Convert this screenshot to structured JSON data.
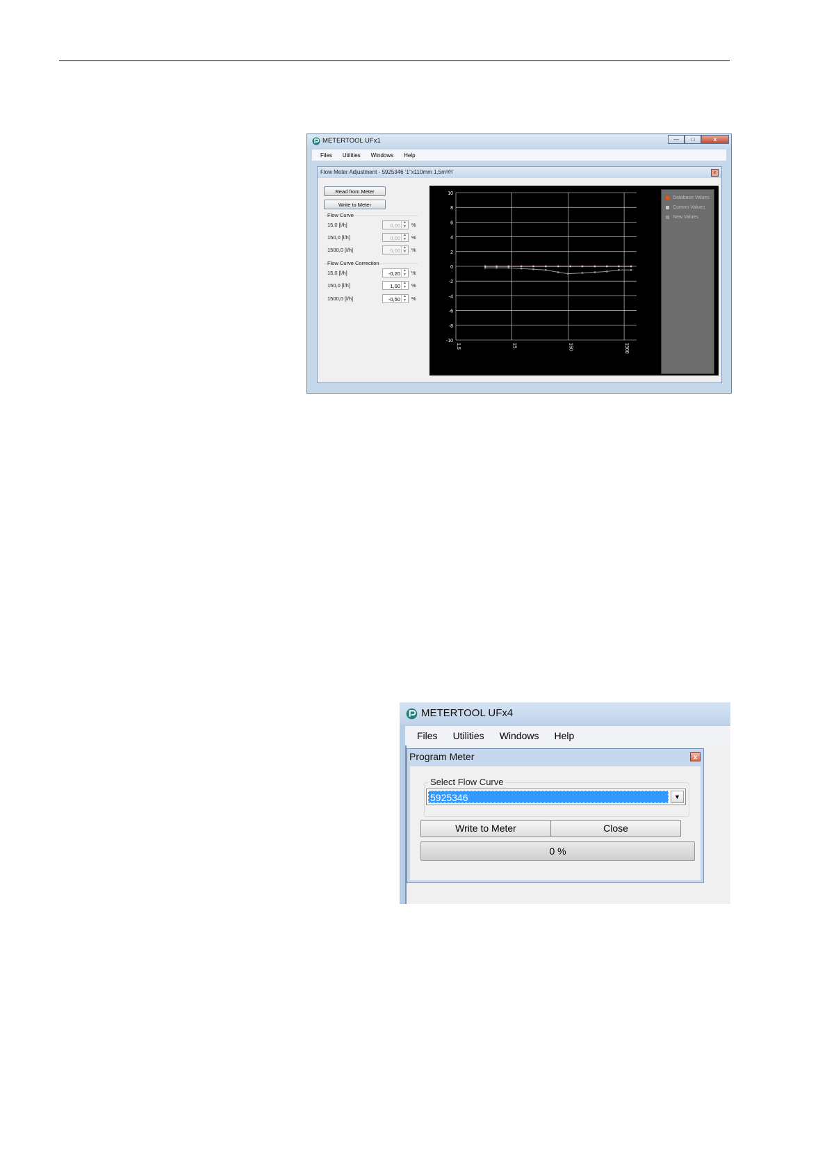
{
  "window1": {
    "title": "METERTOOL UFx1",
    "menu": [
      "Files",
      "Utilities",
      "Windows",
      "Help"
    ],
    "controls": {
      "minimize": "—",
      "maximize": "□",
      "close": "x"
    },
    "subwindow": {
      "title": "Flow Meter Adjustment - 5925346 '1\"x110mm 1,5m³/h'",
      "buttons": {
        "read": "Read from Meter",
        "write": "Write to Meter"
      },
      "flow_curve": {
        "heading": "Flow Curve",
        "rows": [
          {
            "label": "15,0 [l/h]",
            "value": "0,00",
            "unit": "%"
          },
          {
            "label": "150,0 [l/h]",
            "value": "0,00",
            "unit": "%"
          },
          {
            "label": "1500,0 [l/h]",
            "value": "0,00",
            "unit": "%"
          }
        ]
      },
      "correction": {
        "heading": "Flow Curve Correction",
        "rows": [
          {
            "label": "15,0 [l/h]",
            "value": "-0,20",
            "unit": "%"
          },
          {
            "label": "150,0 [l/h]",
            "value": "1,00",
            "unit": "%"
          },
          {
            "label": "1500,0 [l/h]",
            "value": "-0,50",
            "unit": "%"
          }
        ]
      }
    }
  },
  "chart_data": {
    "type": "line",
    "x_scale": "log",
    "xlim": [
      1.5,
      2500
    ],
    "ylim": [
      -10,
      10
    ],
    "yticks": [
      10,
      8,
      6,
      4,
      2,
      0,
      -2,
      -4,
      -6,
      -8,
      -10
    ],
    "xticks": [
      "1,5",
      "15",
      "150",
      "1500"
    ],
    "grid": true,
    "legend_placement": "right panel",
    "series": [
      {
        "name": "Database Values",
        "color": "#e05a20",
        "x": [
          5,
          8,
          13,
          22,
          36,
          60,
          100,
          165,
          270,
          450,
          740,
          1200,
          2000
        ],
        "y": [
          0,
          0,
          0,
          0,
          0,
          0,
          0,
          0,
          0,
          0,
          0,
          0,
          0
        ]
      },
      {
        "name": "Current Values",
        "color": "#c8c8c8",
        "x": [
          5,
          8,
          13,
          22,
          36,
          60,
          100,
          165,
          270,
          450,
          740,
          1200,
          2000
        ],
        "y": [
          0,
          0,
          0,
          0,
          0,
          0,
          0,
          0,
          0,
          0,
          0,
          0,
          0
        ]
      },
      {
        "name": "New Values",
        "color": "#9a9a9a",
        "x": [
          5,
          8,
          13,
          22,
          36,
          60,
          100,
          150,
          270,
          450,
          740,
          1200,
          2000
        ],
        "y": [
          -0.2,
          -0.2,
          -0.2,
          -0.3,
          -0.4,
          -0.5,
          -0.8,
          -1.0,
          -0.9,
          -0.8,
          -0.7,
          -0.5,
          -0.5
        ]
      }
    ]
  },
  "window2": {
    "title": "METERTOOL UFx4",
    "menu": [
      "Files",
      "Utilities",
      "Windows",
      "Help"
    ],
    "dialog": {
      "title": "Program Meter",
      "close": "x",
      "group_label": "Select Flow Curve",
      "selected": "5925346",
      "write_button": "Write to Meter",
      "close_button": "Close",
      "progress": 0,
      "progress_label": "0 %"
    }
  },
  "colors": {
    "accent": "#3399ff",
    "chart_bg": "#000000",
    "legend_bg": "#6d6d6d"
  }
}
